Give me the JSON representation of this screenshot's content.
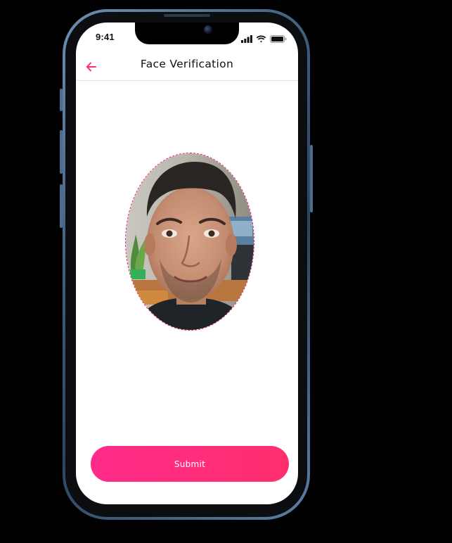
{
  "status_bar": {
    "time": "9:41",
    "icons": [
      "cellular-signal-icon",
      "wifi-icon",
      "battery-icon"
    ]
  },
  "header": {
    "title": "Face Verification",
    "back_icon": "arrow-left-icon"
  },
  "face_preview": {
    "content": "captured face photo"
  },
  "submit": {
    "label": "Submit"
  },
  "colors": {
    "accent": "#ff2b7a",
    "oval_border": "#e21d68",
    "background": "#ffffff",
    "page_bg": "#000000"
  }
}
